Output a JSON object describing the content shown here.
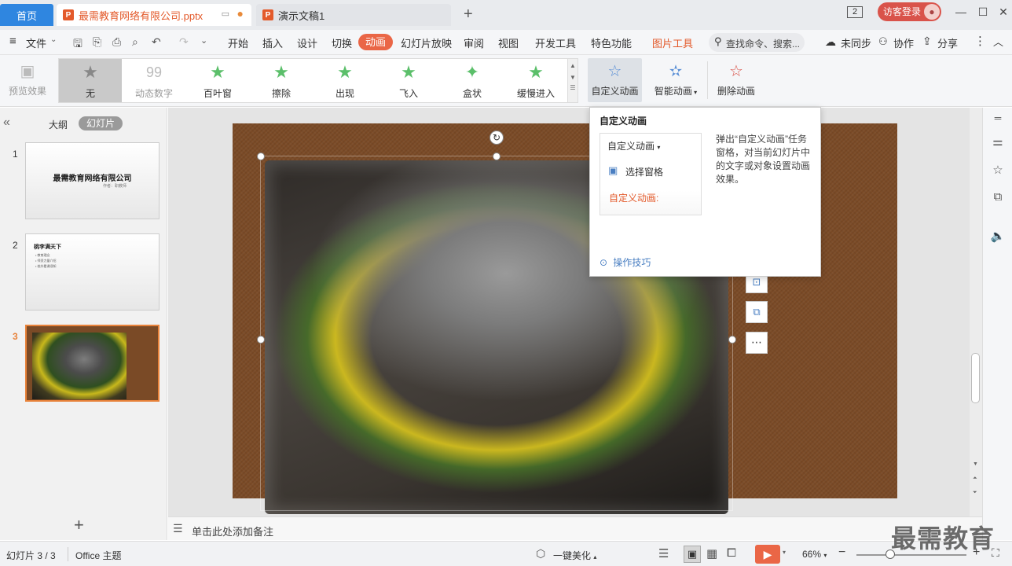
{
  "titlebar": {
    "home_tab": "首页",
    "doc_tab_1": "最需教育网络有限公司.pptx",
    "doc_tab_2": "演示文稿1",
    "add_tab": "+",
    "window_count": "2",
    "login_button": "访客登录"
  },
  "menubar": {
    "file": "文件",
    "items": [
      "开始",
      "插入",
      "设计",
      "切换",
      "动画",
      "幻灯片放映",
      "审阅",
      "视图",
      "开发工具",
      "特色功能",
      "图片工具"
    ],
    "active": "动画",
    "search_placeholder": "查找命令、搜索...",
    "sync": "未同步",
    "collab": "协作",
    "share": "分享"
  },
  "ribbon": {
    "preview": "预览效果",
    "gallery": [
      "无",
      "动态数字",
      "百叶窗",
      "擦除",
      "出现",
      "飞入",
      "盒状",
      "缓慢进入"
    ],
    "custom_animation": "自定义动画",
    "smart_animation": "智能动画",
    "delete_animation": "删除动画"
  },
  "leftpanel": {
    "outline_tab": "大纲",
    "slides_tab": "幻灯片",
    "slides": [
      {
        "num": "1",
        "title": "最需教育网络有限公司",
        "subtitle": "作者：职教师"
      },
      {
        "num": "2",
        "title": "桃李满天下",
        "bullets": [
          "教育理念",
          "师资力量介绍",
          "校外看课须知"
        ]
      },
      {
        "num": "3"
      }
    ],
    "add_slide": "+"
  },
  "popup": {
    "title": "自定义动画",
    "dropdown": "自定义动画",
    "select_pane": "选择窗格",
    "section_label": "自定义动画:",
    "description": "弹出“自定义动画”任务窗格，对当前幻灯片中的文字或对象设置动画效果。",
    "tips": "操作技巧"
  },
  "notes": {
    "placeholder": "单击此处添加备注"
  },
  "statusbar": {
    "slide_info": "幻灯片 3 / 3",
    "theme": "Office 主题",
    "beautify": "一键美化",
    "zoom": "66%",
    "watermark": "最需教育"
  },
  "colors": {
    "accent": "#ea6646",
    "home_tab": "#2f86e0",
    "selected_thumb_border": "#e8823a",
    "slide_bg": "#7a4a26"
  }
}
